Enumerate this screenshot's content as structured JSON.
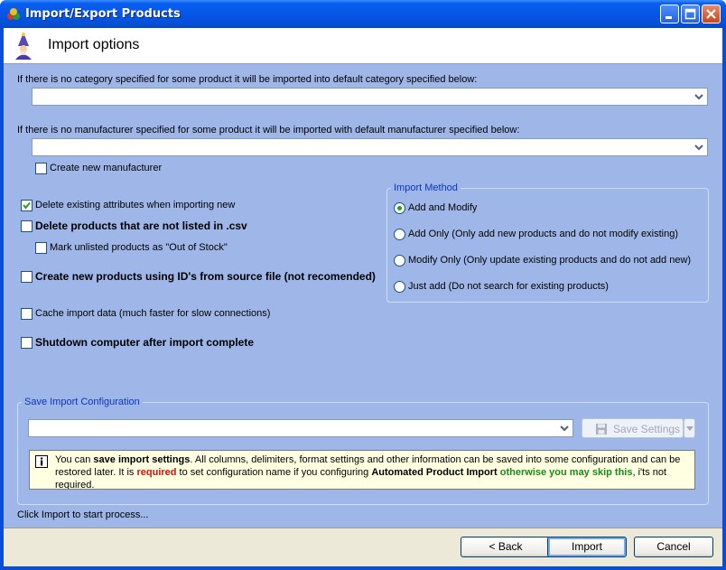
{
  "window": {
    "title": "Import/Export Products"
  },
  "header": {
    "title": "Import options"
  },
  "category": {
    "label": "If there is no category specified for some product it will be imported into default category specified below:",
    "value": ""
  },
  "manufacturer": {
    "label": "If there is no manufacturer specified for some product  it will be imported with default manufacturer specified below:",
    "value": "",
    "create_new_label": "Create new manufacturer",
    "create_new_checked": false
  },
  "options": {
    "delete_attributes": {
      "label": "Delete existing attributes when importing new",
      "checked": true
    },
    "delete_unlisted": {
      "label": "Delete products that are not listed in .csv",
      "checked": false
    },
    "mark_out_of_stock": {
      "label": "Mark unlisted products as \"Out of Stock\"",
      "checked": false
    },
    "create_with_ids": {
      "label": "Create new products using ID's from source file (not recomended)",
      "checked": false
    },
    "cache_data": {
      "label": "Cache import data (much faster for slow connections)",
      "checked": false
    },
    "shutdown": {
      "label": "Shutdown computer after import complete",
      "checked": false
    }
  },
  "import_method": {
    "title": "Import Method",
    "selected": 0,
    "items": [
      {
        "label": "Add and Modify"
      },
      {
        "label": "Add Only (Only add new products and do not modify existing)"
      },
      {
        "label": "Modify Only (Only update existing products and do not add new)"
      },
      {
        "label": "Just add  (Do not search for existing products)"
      }
    ]
  },
  "save_config": {
    "title": "Save Import Configuration",
    "value": "",
    "save_button": "Save Settings",
    "info": {
      "p1": "You can ",
      "p2": "save import settings",
      "p3": ". All columns, delimiters, format settings and other information can be saved into some configuration and can be restored later. It is ",
      "p4": "required",
      "p5": " to set configuration name if you configuring ",
      "p6": "Automated Product Import",
      "p7": " ",
      "p8": "otherwise you may skip this",
      "p9": ", i'ts not required."
    }
  },
  "status": "Click Import to start process...",
  "buttons": {
    "back": "< Back",
    "import": "Import",
    "cancel": "Cancel"
  },
  "colors": {
    "accent": "#0b37b8",
    "panel": "#9fb6e8",
    "check": "#21a121"
  }
}
